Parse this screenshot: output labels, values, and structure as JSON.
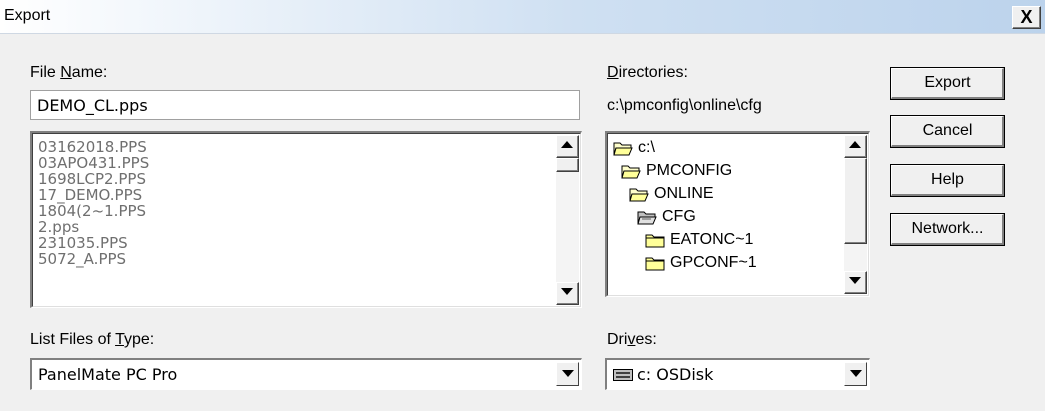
{
  "window": {
    "title": "Export",
    "close_label": "X"
  },
  "file_name": {
    "label_pre": "File ",
    "label_accel": "N",
    "label_post": "ame:",
    "value": "DEMO_CL.pps"
  },
  "files": [
    "03162018.PPS",
    "03APO431.PPS",
    "1698LCP2.PPS",
    "17_DEMO.PPS",
    "1804(2~1.PPS",
    "2.pps",
    "231035.PPS",
    "5072_A.PPS"
  ],
  "directories": {
    "label_pre": "",
    "label_accel": "D",
    "label_post": "irectories:",
    "current_path": "c:\\pmconfig\\online\\cfg",
    "items": [
      {
        "name": "c:\\",
        "icon": "open-folder-icon"
      },
      {
        "name": "PMCONFIG",
        "icon": "open-folder-icon"
      },
      {
        "name": "ONLINE",
        "icon": "open-folder-icon"
      },
      {
        "name": "CFG",
        "icon": "open-folder-selected-icon"
      },
      {
        "name": "EATONC~1",
        "icon": "folder-icon"
      },
      {
        "name": "GPCONF~1",
        "icon": "folder-icon"
      }
    ]
  },
  "file_type": {
    "label_pre": "List Files of ",
    "label_accel": "T",
    "label_post": "ype:",
    "value": "PanelMate PC Pro"
  },
  "drives": {
    "label_pre": "Dri",
    "label_accel": "v",
    "label_post": "es:",
    "value": "c: OSDisk",
    "icon": "drive-icon"
  },
  "buttons": {
    "export": "Export",
    "cancel": "Cancel",
    "help": "Help",
    "network": "Network..."
  }
}
